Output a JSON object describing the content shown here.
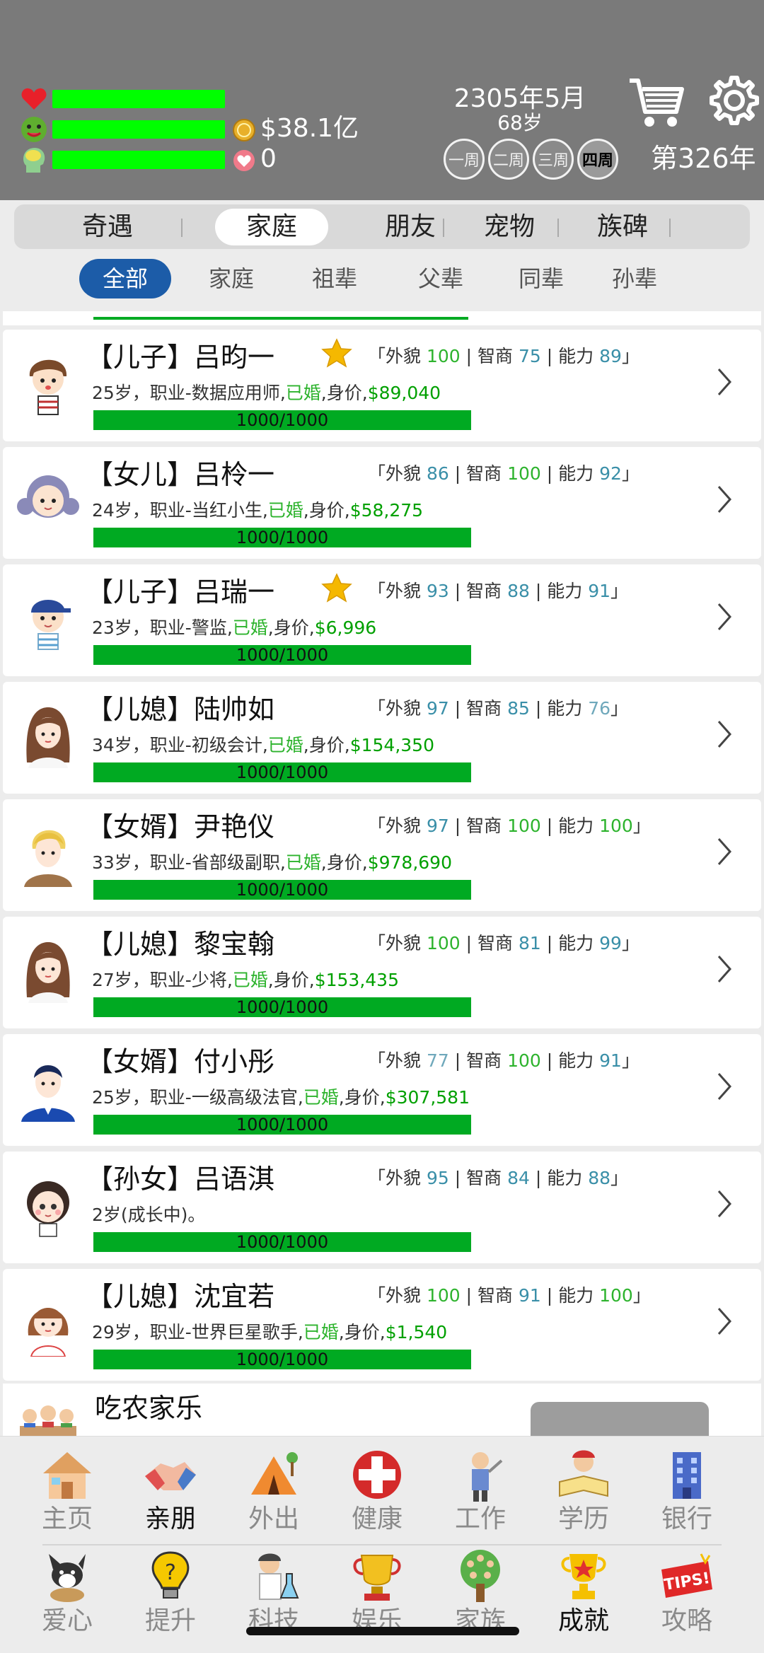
{
  "header": {
    "money": "$38.1亿",
    "happiness": "0",
    "date": "2305年5月",
    "age": "68岁",
    "weeks": [
      "一周",
      "二周",
      "三周",
      "四周"
    ],
    "active_week": 3,
    "year": "第326年"
  },
  "main_tabs": [
    {
      "label": "奇遇"
    },
    {
      "label": "家庭"
    },
    {
      "label": "朋友"
    },
    {
      "label": "宠物"
    },
    {
      "label": "族碑"
    }
  ],
  "active_tab": 1,
  "sub_filters": [
    {
      "label": "全部"
    },
    {
      "label": "家庭"
    },
    {
      "label": "祖辈"
    },
    {
      "label": "父辈"
    },
    {
      "label": "同辈"
    },
    {
      "label": "孙辈"
    }
  ],
  "active_filter": 0,
  "attr_labels": {
    "looks": "「外貌",
    "iq": "智商",
    "ability": "能力",
    "close": "」",
    "sep": "|"
  },
  "members": [
    {
      "name": "【儿子】吕昀一",
      "starred": true,
      "looks": "100",
      "looks_color": "#2db32d",
      "iq": "75",
      "iq_color": "#3a8fa8",
      "ability": "89",
      "ability_color": "#3a8fa8",
      "age_job": "25岁，职业-数据应用师,",
      "married": "已婚",
      "worth_label": ",身价,",
      "worth": "$89,040",
      "hp": "1000/1000",
      "avatar": "boy"
    },
    {
      "name": "【女儿】吕柃一",
      "starred": false,
      "looks": "86",
      "looks_color": "#3a8fa8",
      "iq": "100",
      "iq_color": "#2db32d",
      "ability": "92",
      "ability_color": "#3a8fa8",
      "age_job": "24岁，职业-当红小生,",
      "married": "已婚",
      "worth_label": ",身价,",
      "worth": "$58,275",
      "hp": "1000/1000",
      "avatar": "girl"
    },
    {
      "name": "【儿子】吕瑞一",
      "starred": true,
      "looks": "93",
      "looks_color": "#3a8fa8",
      "iq": "88",
      "iq_color": "#3a8fa8",
      "ability": "91",
      "ability_color": "#3a8fa8",
      "age_job": "23岁，职业-警监,",
      "married": "已婚",
      "worth_label": ",身价,",
      "worth": "$6,996",
      "hp": "1000/1000",
      "avatar": "capboy"
    },
    {
      "name": "【儿媳】陆帅如",
      "starred": false,
      "looks": "97",
      "looks_color": "#3a8fa8",
      "iq": "85",
      "iq_color": "#3a8fa8",
      "ability": "76",
      "ability_color": "#6fa8bb",
      "age_job": "34岁，职业-初级会计,",
      "married": "已婚",
      "worth_label": ",身价,",
      "worth": "$154,350",
      "hp": "1000/1000",
      "avatar": "woman"
    },
    {
      "name": "【女婿】尹艳仪",
      "starred": false,
      "looks": "97",
      "looks_color": "#3a8fa8",
      "iq": "100",
      "iq_color": "#2db32d",
      "ability": "100",
      "ability_color": "#2db32d",
      "age_job": "33岁，职业-省部级副职,",
      "married": "已婚",
      "worth_label": ",身价,",
      "worth": "$978,690",
      "hp": "1000/1000",
      "avatar": "blond"
    },
    {
      "name": "【儿媳】黎宝翰",
      "starred": false,
      "looks": "100",
      "looks_color": "#2db32d",
      "iq": "81",
      "iq_color": "#3a8fa8",
      "ability": "99",
      "ability_color": "#3a8fa8",
      "age_job": "27岁，职业-少将,",
      "married": "已婚",
      "worth_label": ",身价,",
      "worth": "$153,435",
      "hp": "1000/1000",
      "avatar": "woman"
    },
    {
      "name": "【女婿】付小彤",
      "starred": false,
      "looks": "77",
      "looks_color": "#6fa8bb",
      "iq": "100",
      "iq_color": "#2db32d",
      "ability": "91",
      "ability_color": "#3a8fa8",
      "age_job": "25岁，职业-一级高级法官,",
      "married": "已婚",
      "worth_label": ",身价,",
      "worth": "$307,581",
      "hp": "1000/1000",
      "avatar": "suit"
    },
    {
      "name": "【孙女】吕语淇",
      "starred": false,
      "looks": "95",
      "looks_color": "#3a8fa8",
      "iq": "84",
      "iq_color": "#3a8fa8",
      "ability": "88",
      "ability_color": "#3a8fa8",
      "age_job": "2岁(成长中)。",
      "married": "",
      "worth_label": "",
      "worth": "",
      "hp": "1000/1000",
      "avatar": "child"
    },
    {
      "name": "【儿媳】沈宜若",
      "starred": false,
      "looks": "100",
      "looks_color": "#2db32d",
      "iq": "91",
      "iq_color": "#3a8fa8",
      "ability": "100",
      "ability_color": "#2db32d",
      "age_job": "29岁，职业-世界巨星歌手,",
      "married": "已婚",
      "worth_label": ",身价,",
      "worth": "$1,540",
      "hp": "1000/1000",
      "avatar": "bobgirl"
    }
  ],
  "special": {
    "title": "吃农家乐"
  },
  "nav": {
    "row1": [
      {
        "label": "主页",
        "icon": "house-icon"
      },
      {
        "label": "亲朋",
        "icon": "handshake-icon"
      },
      {
        "label": "外出",
        "icon": "tent-icon"
      },
      {
        "label": "健康",
        "icon": "medical-cross-icon"
      },
      {
        "label": "工作",
        "icon": "worker-icon"
      },
      {
        "label": "学历",
        "icon": "reading-icon"
      },
      {
        "label": "银行",
        "icon": "bank-icon"
      }
    ],
    "row2": [
      {
        "label": "爱心",
        "icon": "dog-icon"
      },
      {
        "label": "提升",
        "icon": "bulb-icon"
      },
      {
        "label": "科技",
        "icon": "scientist-icon"
      },
      {
        "label": "娱乐",
        "icon": "trophy-cup-icon"
      },
      {
        "label": "家族",
        "icon": "family-tree-icon"
      },
      {
        "label": "成就",
        "icon": "trophy-icon"
      },
      {
        "label": "攻略",
        "icon": "tips-icon"
      }
    ],
    "strong_labels": [
      "亲朋",
      "成就"
    ]
  },
  "colors": {
    "header_bg": "#7a7a7a",
    "stat_bar": "#00ff00",
    "hp_bar": "#00aa22",
    "filter_active": "#1c5ca8",
    "married": "#2db32d"
  }
}
